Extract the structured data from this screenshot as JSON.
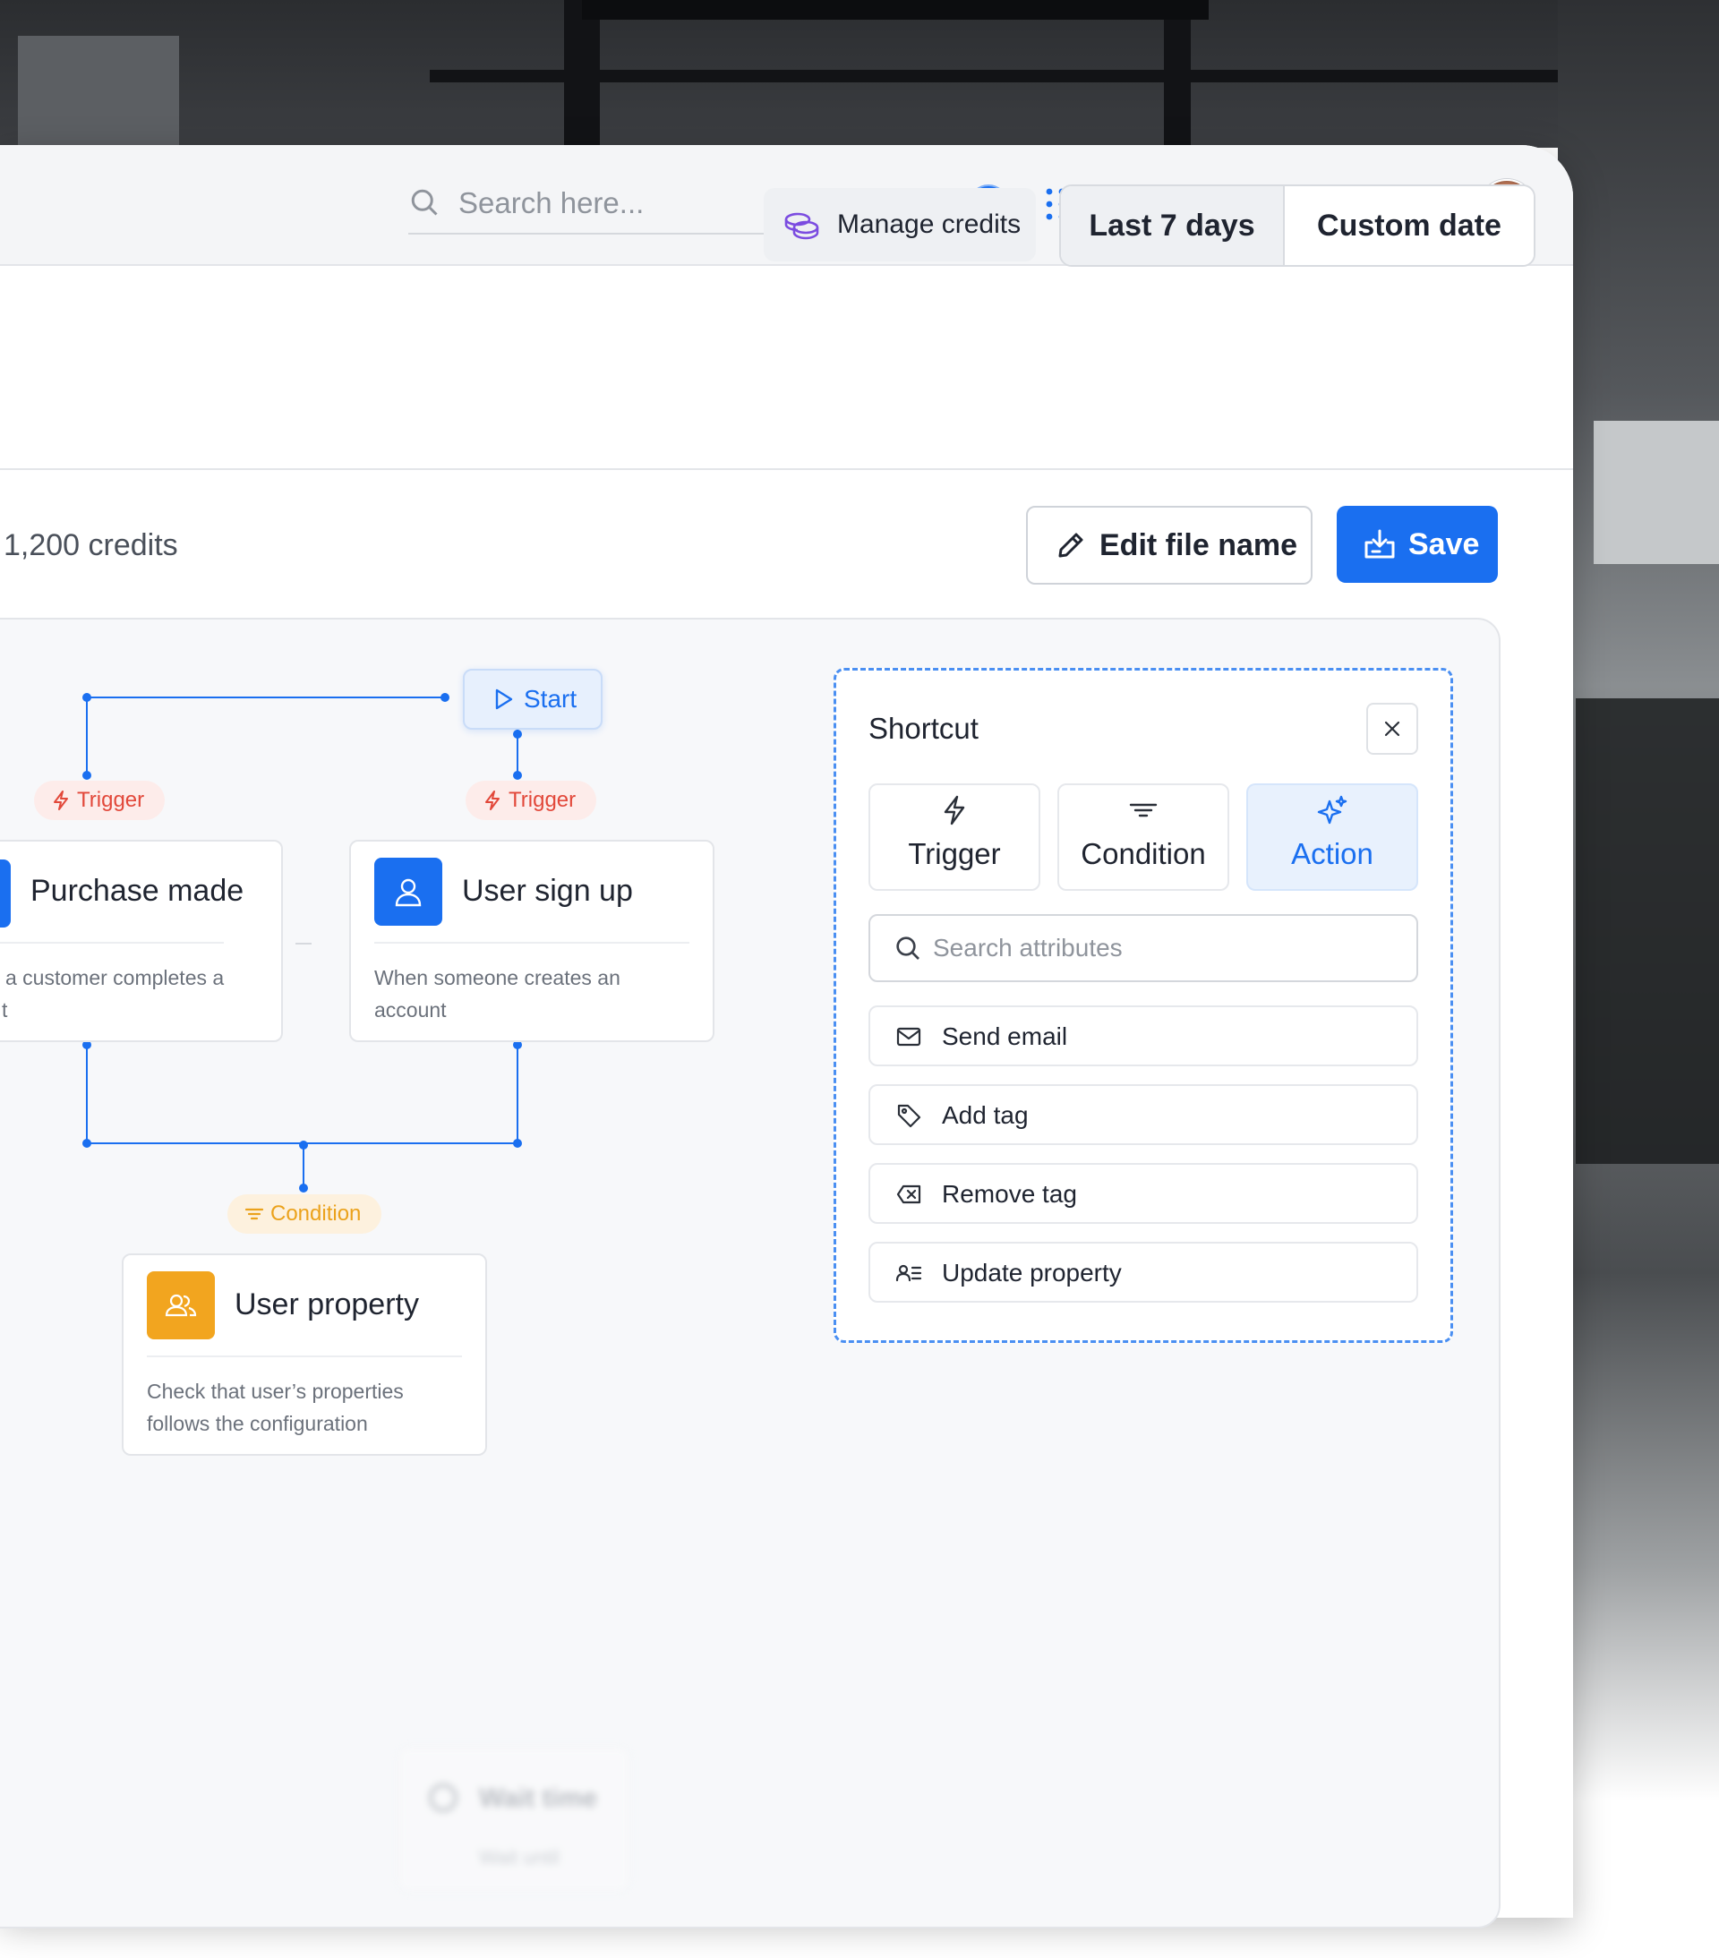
{
  "topbar": {
    "search_placeholder": "Search here...",
    "icons": [
      "search-icon",
      "compass-icon",
      "apps-grid-icon",
      "translate-icon",
      "bell-icon",
      "chat-icon",
      "phone-icon"
    ],
    "accent": "#1a6ff0"
  },
  "toolbar": {
    "manage_credits_label": "Manage credits",
    "range_options": [
      "Last 7 days",
      "Custom date"
    ],
    "range_selected": "Last 7 days"
  },
  "file": {
    "credits_text": "1,200 credits",
    "edit_label": "Edit file name",
    "save_label": "Save"
  },
  "flow": {
    "start_label": "Start",
    "trigger_label": "Trigger",
    "condition_label": "Condition",
    "nodes": [
      {
        "title": "Purchase made",
        "desc_line1": "a customer completes a",
        "desc_line2": "t"
      },
      {
        "title": "User sign up",
        "desc_line1": "When someone creates an",
        "desc_line2": "account"
      },
      {
        "title": "User property",
        "desc_line1": "Check that user’s properties",
        "desc_line2": "follows the configuration"
      }
    ],
    "ghost_node": {
      "title": "Wait time",
      "sub": "Wait until"
    }
  },
  "shortcut": {
    "title": "Shortcut",
    "tabs": [
      "Trigger",
      "Condition",
      "Action"
    ],
    "active_tab": "Action",
    "search_placeholder": "Search attributes",
    "actions": [
      "Send email",
      "Add tag",
      "Remove tag",
      "Update property"
    ]
  },
  "colors": {
    "primary": "#1a6ff0",
    "trigger": "#e2483a",
    "condition": "#eba21c",
    "user_badge": "#1a6ff0",
    "property_badge": "#f2a51f"
  }
}
